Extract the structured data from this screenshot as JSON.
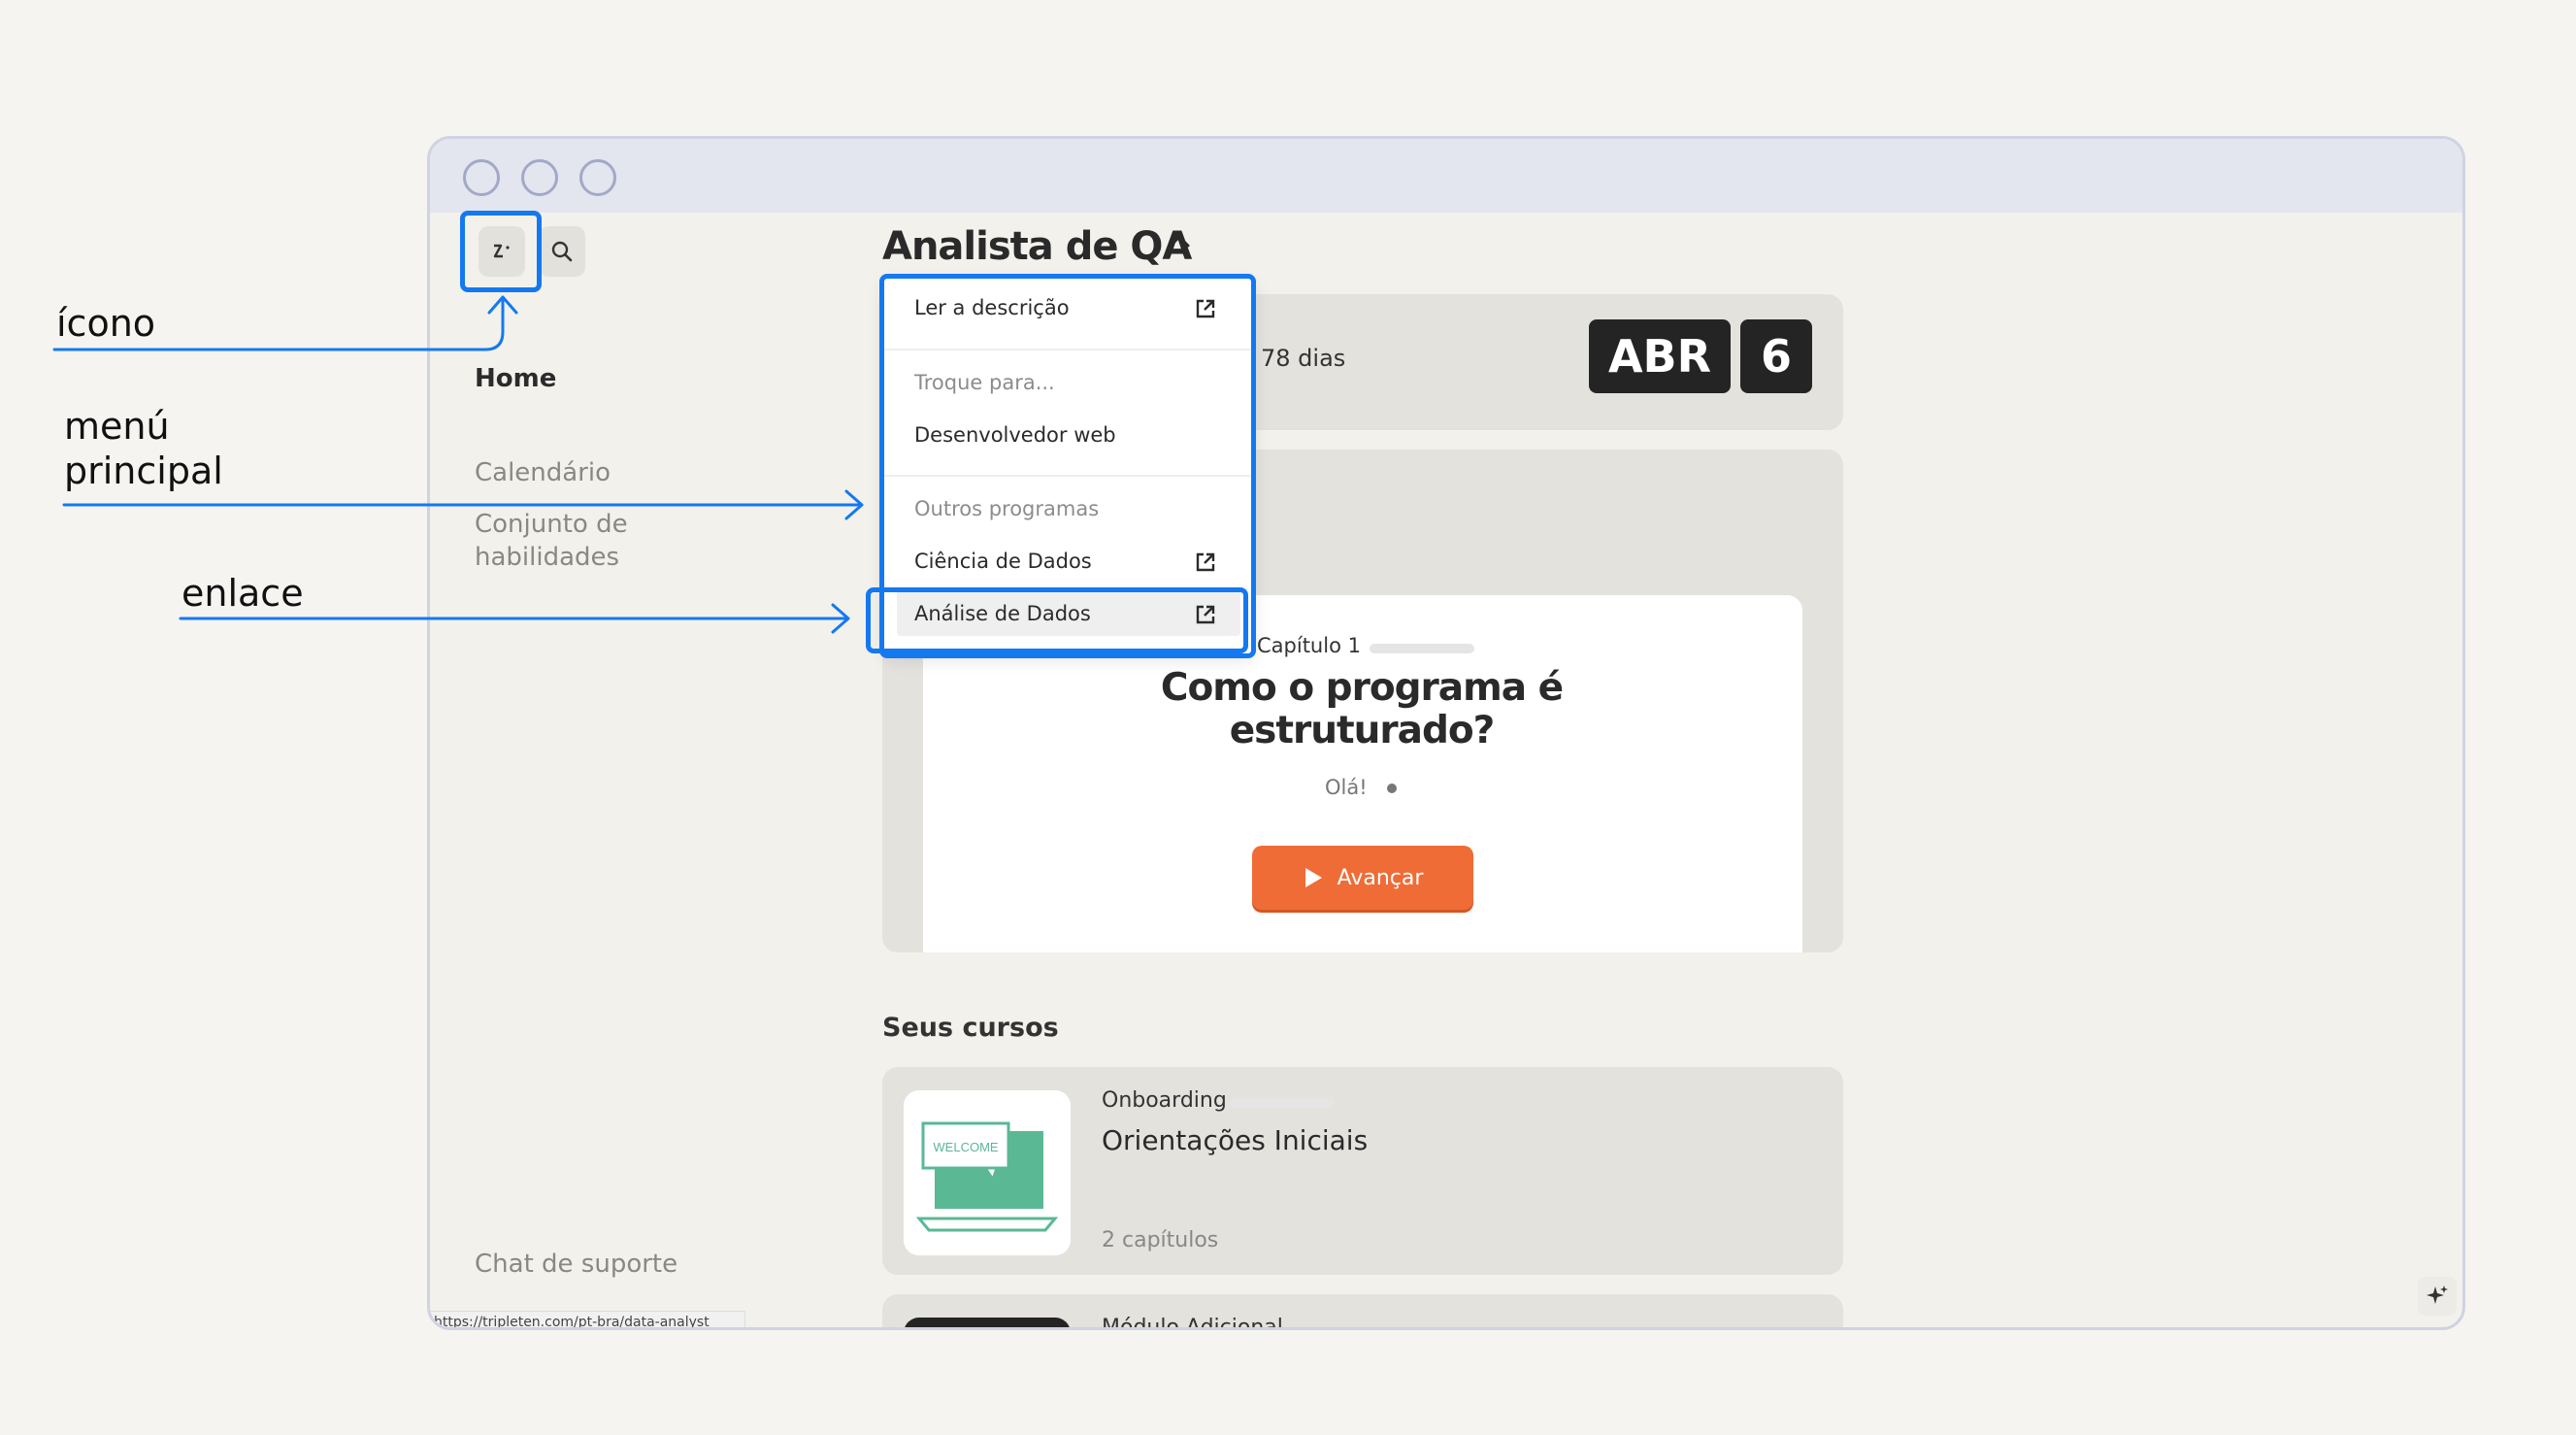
{
  "annotations": {
    "icon_label": "ícono",
    "menu_label_line1": "menú",
    "menu_label_line2": "principal",
    "link_label": "enlace"
  },
  "sidebar": {
    "home": "Home",
    "calendar": "Calendário",
    "skillset_line1": "Conjunto de",
    "skillset_line2": "habilidades",
    "support": "Chat de suporte",
    "status_url": "https://tripleten.com/pt-bra/data-analyst"
  },
  "header": {
    "title": "Analista de QA"
  },
  "countdown": {
    "days_text": "78 dias",
    "month": "ABR",
    "day": "6"
  },
  "dropdown": {
    "read_description": "Ler a descrição",
    "switch_heading": "Troque para...",
    "web_developer": "Desenvolvedor web",
    "other_programs_heading": "Outros programas",
    "data_science": "Ciência de Dados",
    "data_analysis": "Análise de Dados"
  },
  "lesson": {
    "chapter": "Capítulo 1",
    "title_line1": "Como o programa é",
    "title_line2": "estruturado?",
    "hello": "Olá!",
    "advance_button": "Avançar"
  },
  "courses": {
    "heading": "Seus cursos",
    "items": [
      {
        "category": "Onboarding",
        "title": "Orientações Iniciais",
        "chapters": "2 capítulos",
        "thumb_text": "WELCOME"
      },
      {
        "category": "Módulo Adicional"
      }
    ]
  },
  "colors": {
    "accent_annotation": "#1479f0",
    "primary_button": "#ef6c37",
    "date_chip": "#242424",
    "thumb_green": "#5ab894"
  },
  "icons": [
    "tripleten-logo-icon",
    "search-icon",
    "chevron-up-icon",
    "external-link-icon",
    "play-icon",
    "sparkle-icon"
  ]
}
